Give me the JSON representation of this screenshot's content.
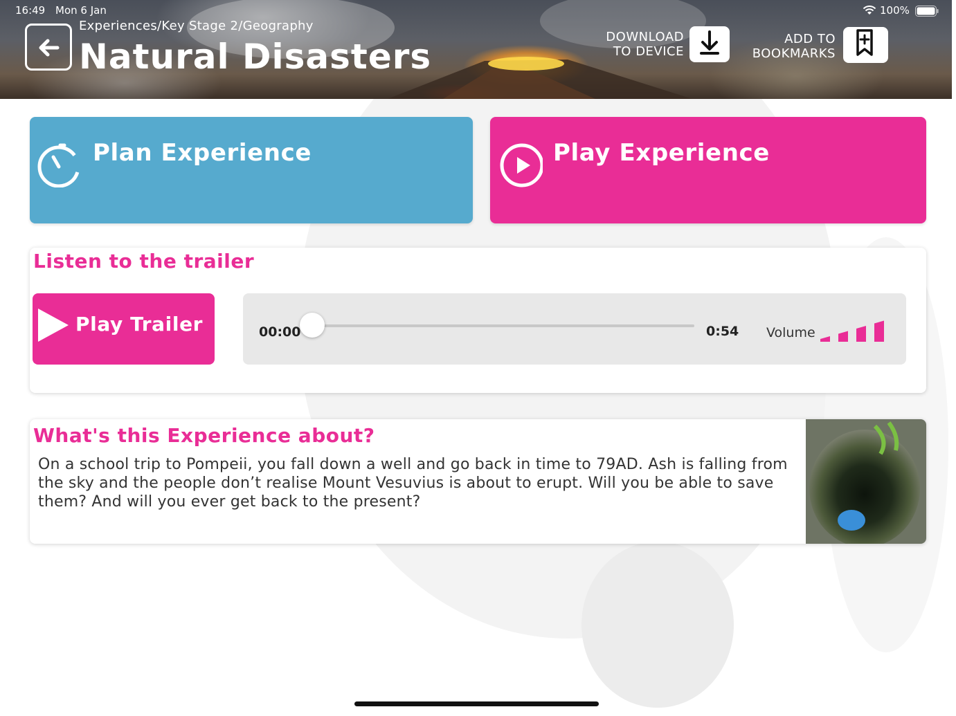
{
  "status_bar": {
    "time": "16:49",
    "date": "Mon 6 Jan",
    "battery": "100%"
  },
  "header": {
    "breadcrumb": "Experiences/Key Stage 2/Geography",
    "title": "Natural Disasters",
    "download_label_line1": "DOWNLOAD",
    "download_label_line2": "TO DEVICE",
    "bookmark_label_line1": "ADD TO",
    "bookmark_label_line2": "BOOKMARKS"
  },
  "actions": {
    "plan_label": "Plan Experience",
    "play_label": "Play Experience"
  },
  "trailer": {
    "heading": "Listen to the trailer",
    "play_label": "Play Trailer",
    "current_time": "00:00",
    "total_time": "0:54",
    "progress_fraction": 0.0,
    "volume_label": "Volume",
    "volume_level": 4,
    "volume_max": 4
  },
  "about": {
    "heading": "What's this Experience about?",
    "description": "On a school trip to Pompeii, you fall down a well and go back in time to 79AD. Ash is falling from the sky and the people don’t realise Mount Vesuvius is about to erupt. Will you be able to save them? And will you ever get back to the present?"
  },
  "colors": {
    "plan_card": "#56aace",
    "pink_accent": "#e92d96",
    "player_bg": "#e8e8e8"
  },
  "icons": {
    "back": "arrow-left-icon",
    "download": "download-icon",
    "bookmark": "bookmark-plus-icon",
    "plan": "timer-icon",
    "play": "play-circle-icon",
    "trailer_play": "play-triangle-icon",
    "volume": "volume-bars-icon"
  }
}
